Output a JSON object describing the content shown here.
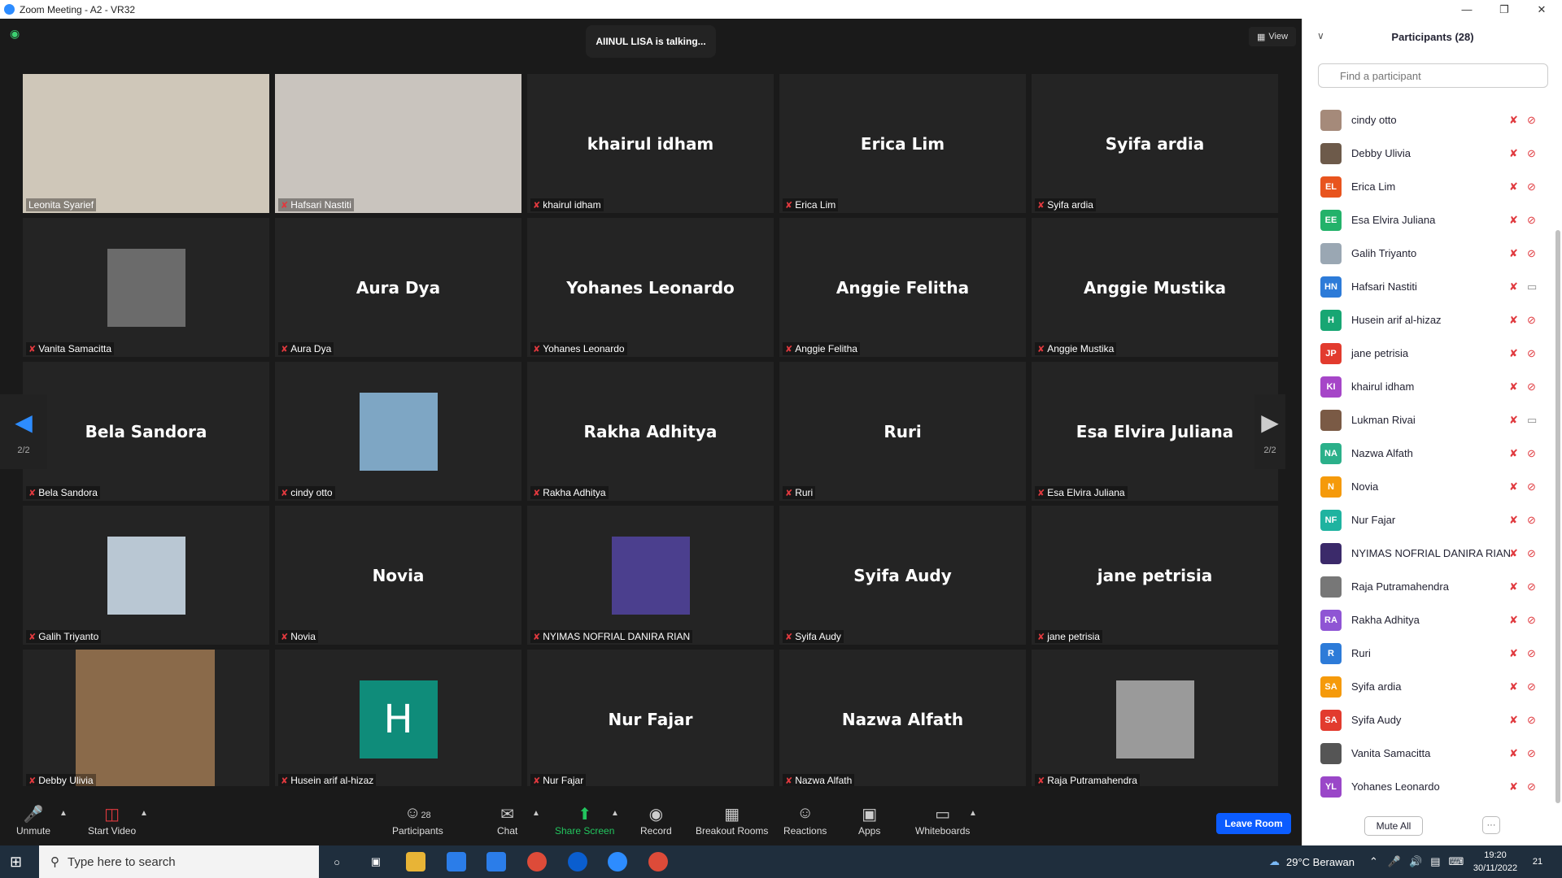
{
  "window": {
    "title": "Zoom Meeting - A2 - VR32"
  },
  "meeting": {
    "talking": "AIINUL LISA is talking...",
    "view_label": "View",
    "page_indicator": "2/2"
  },
  "tiles": [
    {
      "label": "Leonita Syarief",
      "big": "",
      "mode": "video",
      "color": "#cfc7b9"
    },
    {
      "label": "Hafsari Nastiti",
      "big": "",
      "mode": "video",
      "color": "#c9c4be"
    },
    {
      "label": "khairul idham",
      "big": "khairul idham",
      "mode": "name"
    },
    {
      "label": "Erica Lim",
      "big": "Erica Lim",
      "mode": "name"
    },
    {
      "label": "Syifa ardia",
      "big": "Syifa ardia",
      "mode": "name"
    },
    {
      "label": "Vanita Samacitta",
      "big": "",
      "mode": "photo",
      "color": "#6b6b6b"
    },
    {
      "label": "Aura Dya",
      "big": "Aura Dya",
      "mode": "name"
    },
    {
      "label": "Yohanes Leonardo",
      "big": "Yohanes Leonardo",
      "mode": "name"
    },
    {
      "label": "Anggie Felitha",
      "big": "Anggie Felitha",
      "mode": "name"
    },
    {
      "label": "Anggie Mustika",
      "big": "Anggie Mustika",
      "mode": "name"
    },
    {
      "label": "Bela Sandora",
      "big": "Bela Sandora",
      "mode": "name"
    },
    {
      "label": "cindy otto",
      "big": "",
      "mode": "photo",
      "color": "#7ea6c4"
    },
    {
      "label": "Rakha Adhitya",
      "big": "Rakha Adhitya",
      "mode": "name"
    },
    {
      "label": "Ruri",
      "big": "Ruri",
      "mode": "name"
    },
    {
      "label": "Esa Elvira Juliana",
      "big": "Esa Elvira Juliana",
      "mode": "name"
    },
    {
      "label": "Galih Triyanto",
      "big": "",
      "mode": "photo",
      "color": "#b9c7d3"
    },
    {
      "label": "Novia",
      "big": "Novia",
      "mode": "name"
    },
    {
      "label": "NYIMAS NOFRIAL DANIRA RIAN",
      "big": "",
      "mode": "photo",
      "color": "#4b3f8e"
    },
    {
      "label": "Syifa Audy",
      "big": "Syifa Audy",
      "mode": "name"
    },
    {
      "label": "jane petrisia",
      "big": "jane petrisia",
      "mode": "name"
    },
    {
      "label": "Debby Ulivia",
      "big": "",
      "mode": "video-narrow",
      "color": "#8a6a4a"
    },
    {
      "label": "Husein arif al-hizaz",
      "big": "H",
      "mode": "letter"
    },
    {
      "label": "Nur Fajar",
      "big": "Nur Fajar",
      "mode": "name"
    },
    {
      "label": "Nazwa Alfath",
      "big": "Nazwa Alfath",
      "mode": "name"
    },
    {
      "label": "Raja Putramahendra",
      "big": "",
      "mode": "photo",
      "color": "#9a9a9a"
    }
  ],
  "toolbar": {
    "unmute": "Unmute",
    "start_video": "Start Video",
    "participants": "Participants",
    "participants_count": "28",
    "chat": "Chat",
    "share_screen": "Share Screen",
    "record": "Record",
    "breakout_rooms": "Breakout Rooms",
    "reactions": "Reactions",
    "apps": "Apps",
    "whiteboards": "Whiteboards",
    "leave": "Leave Room"
  },
  "panel": {
    "title": "Participants (28)",
    "search_placeholder": "Find a participant",
    "mute_all": "Mute All",
    "more": "···",
    "participants": [
      {
        "name": "cindy otto",
        "initials": "",
        "color": "#a58a7a",
        "cam_on": false
      },
      {
        "name": "Debby Ulivia",
        "initials": "",
        "color": "#6d5a4a",
        "cam_on": false
      },
      {
        "name": "Erica Lim",
        "initials": "EL",
        "color": "#e8541e",
        "cam_on": false
      },
      {
        "name": "Esa Elvira Juliana",
        "initials": "EE",
        "color": "#23b26a",
        "cam_on": false
      },
      {
        "name": "Galih Triyanto",
        "initials": "",
        "color": "#9aa7b3",
        "cam_on": false
      },
      {
        "name": "Hafsari Nastiti",
        "initials": "HN",
        "color": "#2d7bd8",
        "cam_on": true
      },
      {
        "name": "Husein arif al-hizaz",
        "initials": "H",
        "color": "#17a673",
        "cam_on": false
      },
      {
        "name": "jane petrisia",
        "initials": "JP",
        "color": "#e23b2e",
        "cam_on": false
      },
      {
        "name": "khairul idham",
        "initials": "KI",
        "color": "#a646c8",
        "cam_on": false
      },
      {
        "name": "Lukman Rivai",
        "initials": "",
        "color": "#7a5a45",
        "cam_on": true
      },
      {
        "name": "Nazwa Alfath",
        "initials": "NA",
        "color": "#2bb08a",
        "cam_on": false
      },
      {
        "name": "Novia",
        "initials": "N",
        "color": "#f59a0b",
        "cam_on": false
      },
      {
        "name": "Nur Fajar",
        "initials": "NF",
        "color": "#1fb3a0",
        "cam_on": false
      },
      {
        "name": "NYIMAS NOFRIAL DANIRA RIAN",
        "initials": "",
        "color": "#3b2a6a",
        "cam_on": false
      },
      {
        "name": "Raja Putramahendra",
        "initials": "",
        "color": "#777777",
        "cam_on": false
      },
      {
        "name": "Rakha Adhitya",
        "initials": "RA",
        "color": "#8f55d4",
        "cam_on": false
      },
      {
        "name": "Ruri",
        "initials": "R",
        "color": "#2d7bd8",
        "cam_on": false
      },
      {
        "name": "Syifa ardia",
        "initials": "SA",
        "color": "#f59a0b",
        "cam_on": false
      },
      {
        "name": "Syifa Audy",
        "initials": "SA",
        "color": "#e23b2e",
        "cam_on": false
      },
      {
        "name": "Vanita Samacitta",
        "initials": "",
        "color": "#555555",
        "cam_on": false
      },
      {
        "name": "Yohanes Leonardo",
        "initials": "YL",
        "color": "#9a47c8",
        "cam_on": false
      }
    ]
  },
  "taskbar": {
    "search_placeholder": "Type here to search",
    "weather": "29°C  Berawan",
    "time": "19:20",
    "date": "30/11/2022",
    "notif_count": "21"
  }
}
